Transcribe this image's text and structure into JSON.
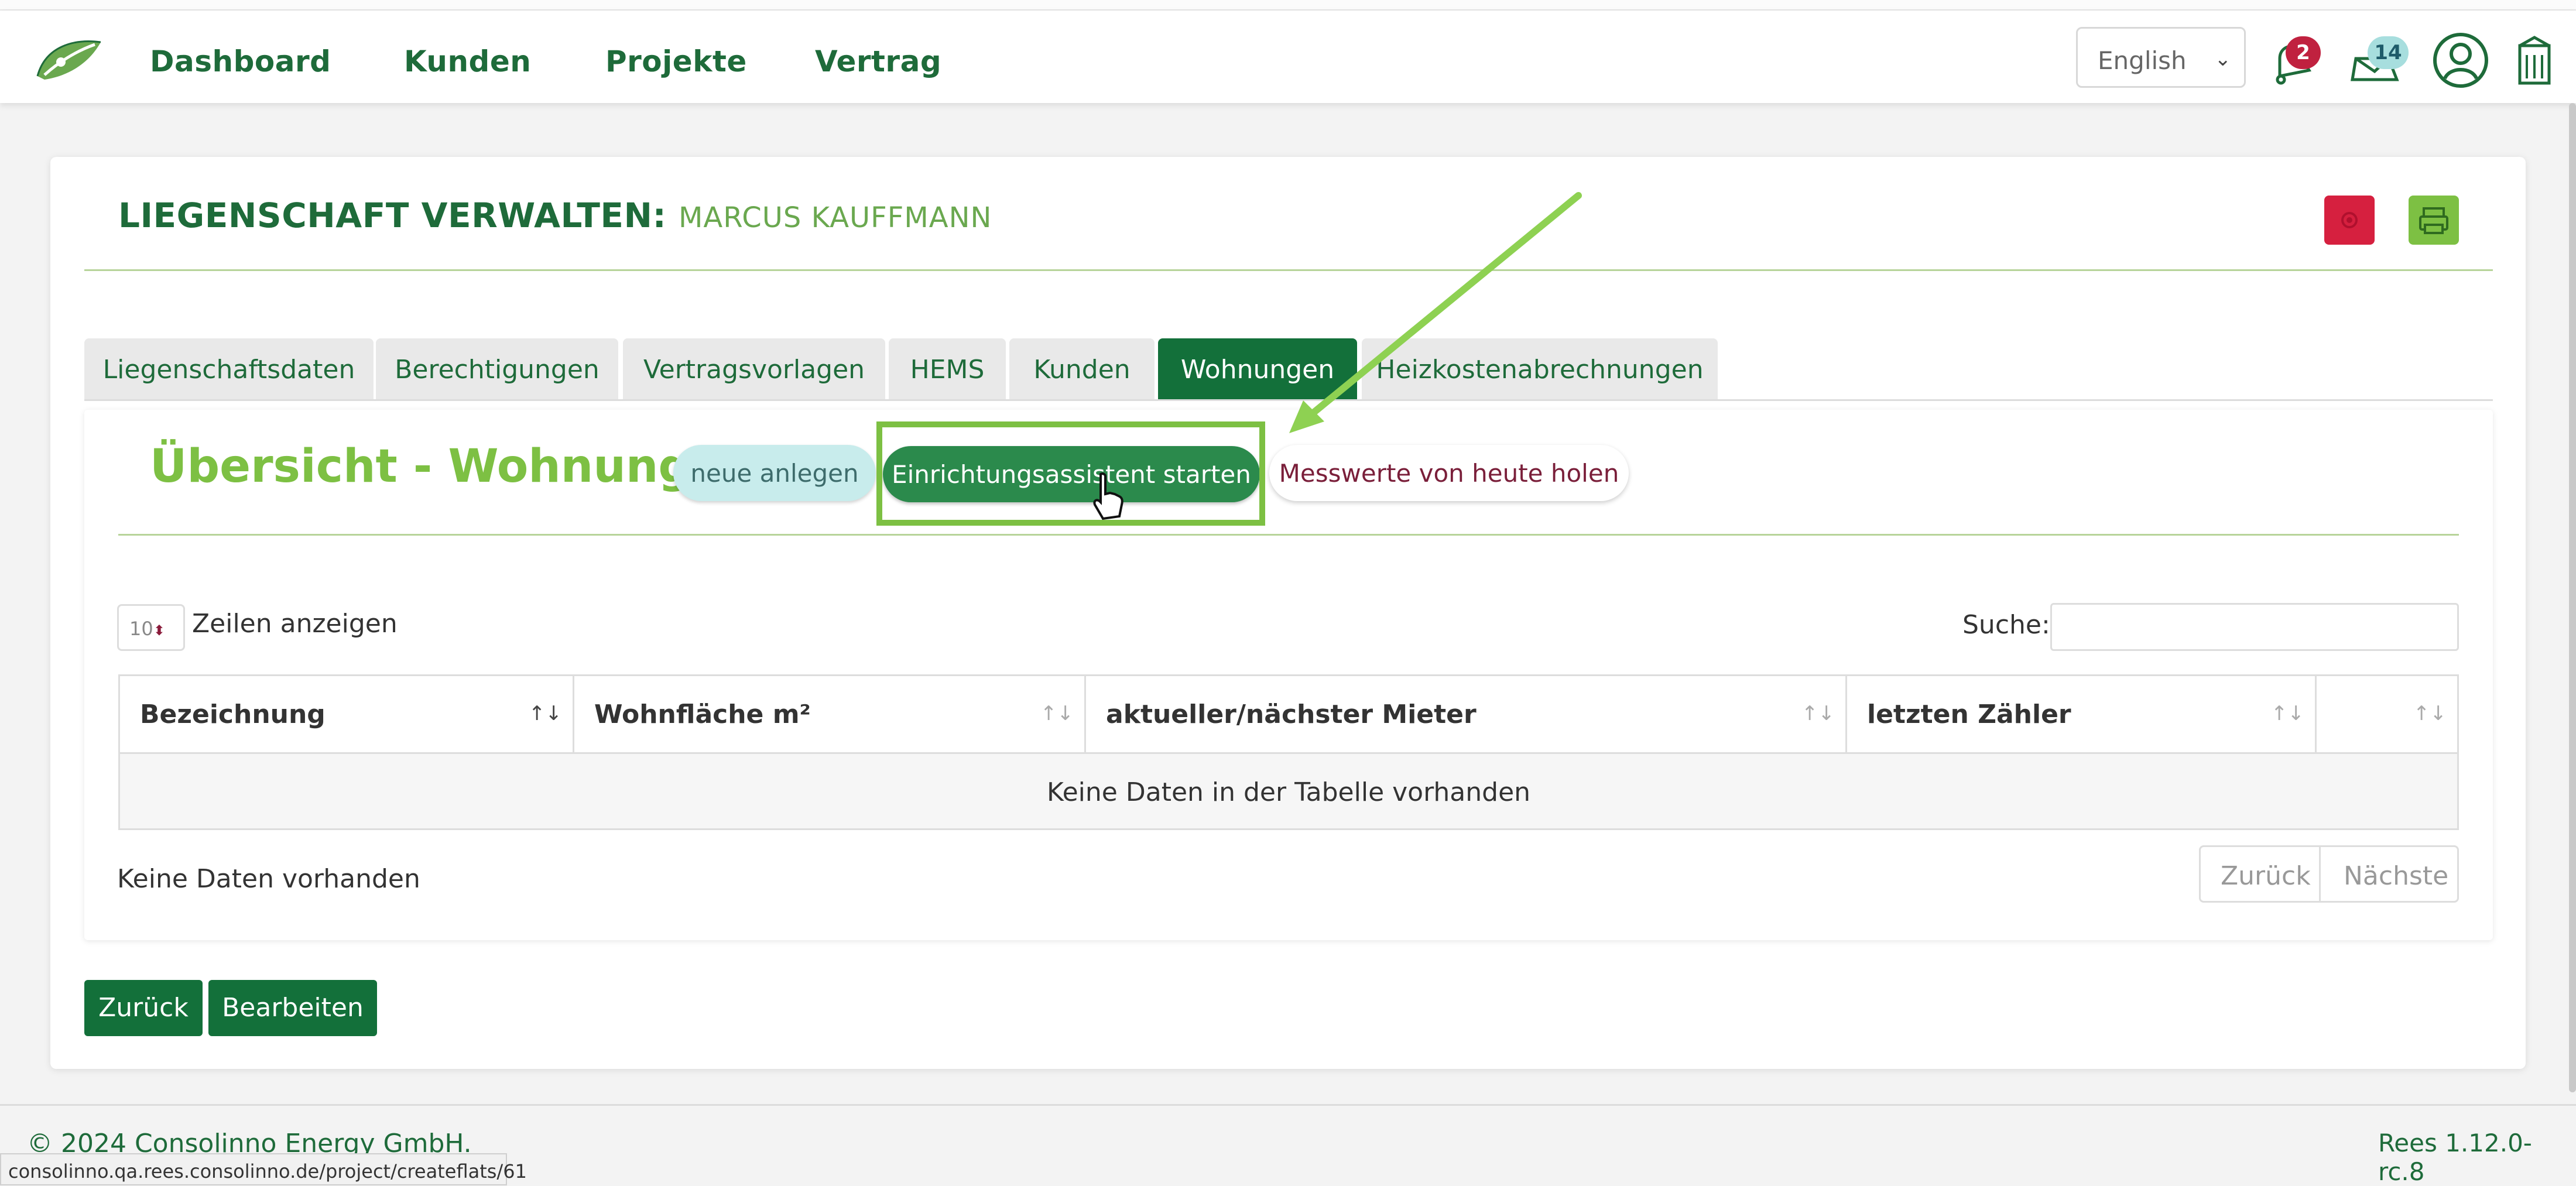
{
  "nav": {
    "items": [
      "Dashboard",
      "Kunden",
      "Projekte",
      "Vertrag"
    ],
    "language": "English",
    "notifications_count": "2",
    "messages_count": "14"
  },
  "page": {
    "title": "LIEGENSCHAFT VERWALTEN:",
    "subtitle": "MARCUS KAUFFMANN"
  },
  "tabs": [
    "Liegenschaftsdaten",
    "Berechtigungen",
    "Vertragsvorlagen",
    "HEMS",
    "Kunden",
    "Wohnungen",
    "Heizkostenabrechnungen"
  ],
  "active_tab": "Wohnungen",
  "section": {
    "title": "Übersicht - Wohnungen",
    "buttons": {
      "new": "neue anlegen",
      "assistant": "Einrichtungsassistent starten",
      "measure": "Messwerte von heute holen"
    }
  },
  "table": {
    "length_value": "10",
    "length_label": "Zeilen anzeigen",
    "search_label": "Suche:",
    "search_value": "",
    "columns": [
      "Bezeichnung",
      "Wohnfläche m²",
      "aktueller/nächster Mieter",
      "letzten Zähler",
      ""
    ],
    "empty_text": "Keine Daten in der Tabelle vorhanden",
    "info": "Keine Daten vorhanden",
    "prev": "Zurück",
    "next": "Nächste"
  },
  "actions": {
    "back": "Zurück",
    "edit": "Bearbeiten"
  },
  "footer": {
    "copyright": "© 2024 Consolinno Energy GmbH.",
    "version": "Rees 1.12.0-rc.8"
  },
  "status_url": "consolinno.qa.rees.consolinno.de/project/createflats/61",
  "colors": {
    "brand_green": "#13703a",
    "accent_green": "#7dc043",
    "danger": "#d6203f"
  }
}
